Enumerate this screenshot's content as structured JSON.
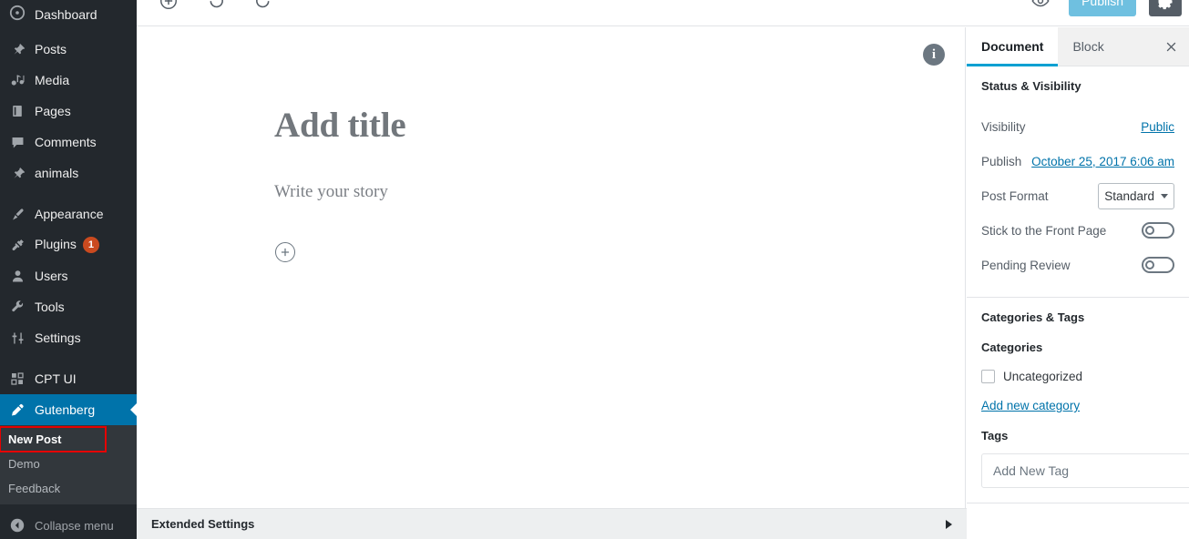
{
  "adminmenu": {
    "items": [
      {
        "label": "Dashboard",
        "icon": "dashboard-icon"
      },
      {
        "label": "Posts",
        "icon": "pin-icon"
      },
      {
        "label": "Media",
        "icon": "media-icon"
      },
      {
        "label": "Pages",
        "icon": "page-icon"
      },
      {
        "label": "Comments",
        "icon": "comment-icon"
      },
      {
        "label": "animals",
        "icon": "pin-icon"
      },
      {
        "label": "Appearance",
        "icon": "brush-icon"
      },
      {
        "label": "Plugins",
        "icon": "plug-icon",
        "badge": "1"
      },
      {
        "label": "Users",
        "icon": "user-icon"
      },
      {
        "label": "Tools",
        "icon": "wrench-icon"
      },
      {
        "label": "Settings",
        "icon": "sliders-icon"
      },
      {
        "label": "CPT UI",
        "icon": "grid-icon"
      },
      {
        "label": "Gutenberg",
        "icon": "pencil-icon",
        "current": true
      }
    ],
    "submenu": [
      {
        "label": "New Post",
        "current": true,
        "highlighted": true
      },
      {
        "label": "Demo"
      },
      {
        "label": "Feedback"
      }
    ],
    "collapse_label": "Collapse menu",
    "collapse_icon": "collapse-left-icon"
  },
  "toolbar": {
    "inserter_icon": "add-block-icon",
    "undo_icon": "undo-icon",
    "redo_icon": "redo-icon",
    "preview_icon": "eye-preview-icon",
    "publish_label": "Publish",
    "settings_icon": "gear-icon"
  },
  "editor": {
    "info_icon": "info-icon",
    "title_placeholder": "Add title",
    "body_placeholder": "Write your story",
    "inserter_icon": "plus-circle-icon"
  },
  "extended": {
    "label": "Extended Settings",
    "caret_icon": "triangle-right-icon"
  },
  "settings": {
    "tabs": [
      {
        "label": "Document",
        "active": true
      },
      {
        "label": "Block",
        "active": false
      }
    ],
    "close_icon": "close-icon",
    "status_panel": {
      "title": "Status & Visibility",
      "visibility_label": "Visibility",
      "visibility_value": "Public",
      "publish_label": "Publish",
      "publish_value": "October 25, 2017 6:06 am",
      "post_format_label": "Post Format",
      "post_format_value": "Standard",
      "post_format_options": [
        "Standard"
      ],
      "sticky_label": "Stick to the Front Page",
      "sticky_on": false,
      "pending_label": "Pending Review",
      "pending_on": false
    },
    "taxonomy_panel": {
      "title": "Categories & Tags",
      "categories_label": "Categories",
      "categories": [
        {
          "label": "Uncategorized",
          "checked": false
        }
      ],
      "add_category_label": "Add new category",
      "tags_label": "Tags",
      "tags_placeholder": "Add New Tag",
      "tags_value": ""
    }
  },
  "colors": {
    "admin_bg": "#23282d",
    "admin_submenu_bg": "#32373c",
    "accent_blue": "#0073aa",
    "tab_underline": "#00a0d2",
    "badge": "#ca4a1f",
    "highlight": "#e60000",
    "publish_btn": "#6fc0e0"
  }
}
